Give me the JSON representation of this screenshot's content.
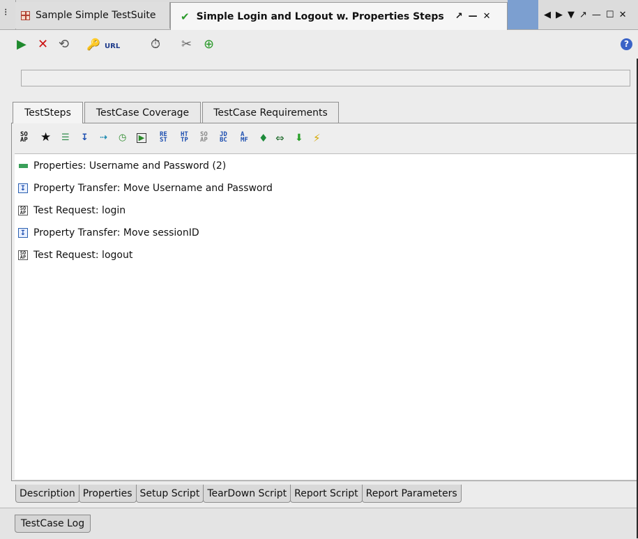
{
  "doc_tabs": {
    "left_edge_glyph": "⁝",
    "suite": {
      "label": "Sample Simple TestSuite"
    },
    "testcase": {
      "label": "Simple Login and Logout w. Properties Steps",
      "controls": [
        "↗",
        "—",
        "✕"
      ],
      "check_glyph": "✔"
    },
    "nav": [
      "◀",
      "▶",
      "▼",
      "↗",
      "—",
      "☐",
      "✕"
    ]
  },
  "main_toolbar": {
    "run_glyph": "▶",
    "cancel_glyph": "✕",
    "loop_glyph": "⟲",
    "credentials_glyph": "🔑",
    "url_label": "URL",
    "timer_glyph": "⏱",
    "tools_glyph": "✂",
    "add_glyph": "⊕",
    "help_glyph": "?"
  },
  "colors": {
    "run": "#1f8a2e",
    "cancel": "#cc1111",
    "accent_blue": "#7c9fd0",
    "help": "#3a63c7"
  },
  "content_tabs": [
    "TestSteps",
    "TestCase Coverage",
    "TestCase Requirements"
  ],
  "steps_toolbar": {
    "soap": "SO\nAP",
    "star": "★",
    "props": "☰",
    "transfer": "↧",
    "goto": "⇢",
    "delay": "◷",
    "run": "▶",
    "rest": "RE\nST",
    "http": "HT\nTP",
    "soap2": "SO\nAP",
    "jdbc": "JD\nBC",
    "amf": "A\nMF",
    "mock": "♦",
    "manual": "⇔",
    "green": "⬇",
    "lightning": "⚡"
  },
  "test_steps": [
    {
      "type": "properties",
      "icon": "properties-icon",
      "label": "Properties: Username and Password (2)"
    },
    {
      "type": "transfer",
      "icon": "property-transfer-icon",
      "label": "Property Transfer: Move Username and Password"
    },
    {
      "type": "soap",
      "icon": "soap-request-icon",
      "label": "Test Request: login"
    },
    {
      "type": "transfer",
      "icon": "property-transfer-icon",
      "label": "Property Transfer: Move sessionID"
    },
    {
      "type": "soap",
      "icon": "soap-request-icon",
      "label": "Test Request: logout"
    }
  ],
  "bottom_tabs": [
    "Description",
    "Properties",
    "Setup Script",
    "TearDown Script",
    "Report Script",
    "Report Parameters"
  ],
  "log_tab": "TestCase Log"
}
